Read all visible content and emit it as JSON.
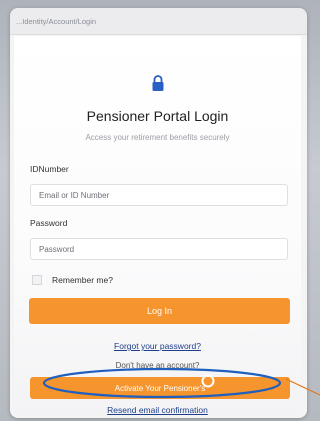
{
  "browser": {
    "url": "...Identity/Account/Login"
  },
  "login": {
    "title": "Pensioner Portal Login",
    "subtitle": "Access your retirement benefits securely",
    "id_label": "IDNumber",
    "id_placeholder": "Email or ID Number",
    "password_label": "Password",
    "password_placeholder": "Password",
    "remember_label": "Remember me?",
    "login_button": "Log In",
    "forgot_link": "Forgot your password?",
    "no_account_text": "Don't have an account?",
    "activate_button": "Activate Your Pensioner's",
    "resend_link": "Resend email confirmation"
  },
  "colors": {
    "accent": "#f6942d",
    "link": "#1e3f8a",
    "annotation": "#1f5fbf"
  },
  "icons": {
    "lock": "lock-icon"
  }
}
